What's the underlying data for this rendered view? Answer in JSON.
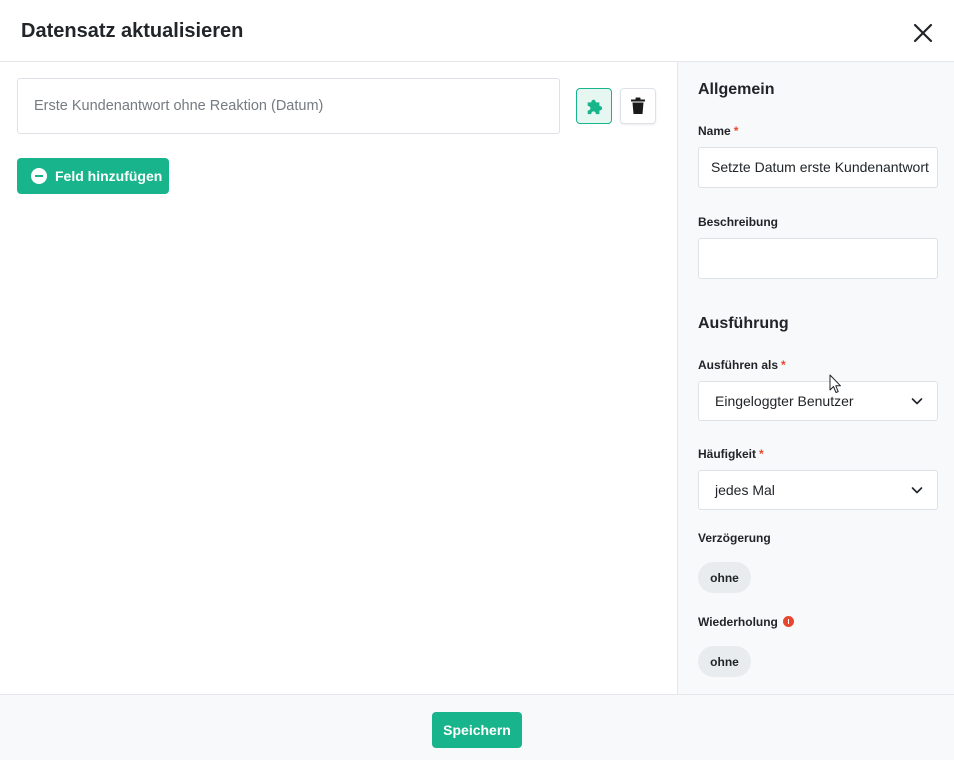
{
  "dialog": {
    "title": "Datensatz aktualisieren",
    "close_icon": "close-icon"
  },
  "left": {
    "field_placeholder": "Erste Kundenantwort ohne Reaktion (Datum)",
    "plugin_icon": "puzzle-icon",
    "delete_icon": "trash-icon",
    "add_field_label": "Feld hinzufügen"
  },
  "sidebar": {
    "general_title": "Allgemein",
    "name_label": "Name",
    "name_value": "Setzte Datum erste Kundenantwort",
    "description_label": "Beschreibung",
    "description_value": "",
    "execution_title": "Ausführung",
    "run_as_label": "Ausführen als",
    "run_as_value": "Eingeloggter Benutzer",
    "frequency_label": "Häufigkeit",
    "frequency_value": "jedes Mal",
    "delay_label": "Verzögerung",
    "delay_value": "ohne",
    "repeat_label": "Wiederholung",
    "repeat_value": "ohne",
    "required_marker": "*"
  },
  "footer": {
    "save_label": "Speichern"
  },
  "colors": {
    "accent": "#18b48b",
    "required": "#e8472f"
  }
}
